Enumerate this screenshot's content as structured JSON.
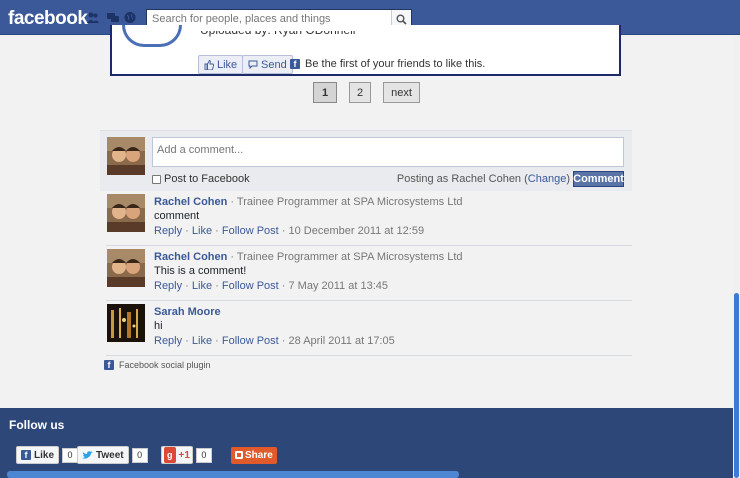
{
  "topbar": {
    "logo": "facebook",
    "search_placeholder": "Search for people, places and things"
  },
  "post": {
    "uploaded_by": "Uploaded by: Ryan ODonnell",
    "like_label": "Like",
    "send_label": "Send",
    "like_note": "Be the first of your friends to like this."
  },
  "pagination": {
    "pages": [
      "1",
      "2"
    ],
    "current": "1",
    "next_label": "next"
  },
  "compose": {
    "placeholder": "Add a comment...",
    "post_to_fb_label": "Post to Facebook",
    "posting_as_prefix": "Posting as Rachel Cohen (",
    "change_label": "Change",
    "posting_as_suffix": ")",
    "comment_button": "Comment"
  },
  "comments": [
    {
      "name": "Rachel Cohen",
      "title": " · Trainee Programmer at SPA Microsystems Ltd",
      "text": "comment",
      "reply": "Reply",
      "like": "Like",
      "follow": "Follow Post",
      "date": " · 10 December 2011 at 12:59"
    },
    {
      "name": "Rachel Cohen",
      "title": " · Trainee Programmer at SPA Microsystems Ltd",
      "text": "This is a comment!",
      "reply": "Reply",
      "like": "Like",
      "follow": "Follow Post",
      "date": " · 7 May 2011 at 13:45"
    },
    {
      "name": "Sarah Moore",
      "title": "",
      "text": "hi",
      "reply": "Reply",
      "like": "Like",
      "follow": "Follow Post",
      "date": " · 28 April 2011 at 17:05"
    }
  ],
  "social_plugin": "Facebook social plugin",
  "footer": {
    "follow_us": "Follow us",
    "like_label": "Like",
    "like_count": "0",
    "tweet_label": "Tweet",
    "tweet_count": "0",
    "gplus_label": "+1",
    "gplus_count": "0",
    "share_label": "Share"
  },
  "colors": {
    "brand": "#3b5998",
    "footer": "#2e4779",
    "scroll_thumb": "#3b7cd6"
  }
}
